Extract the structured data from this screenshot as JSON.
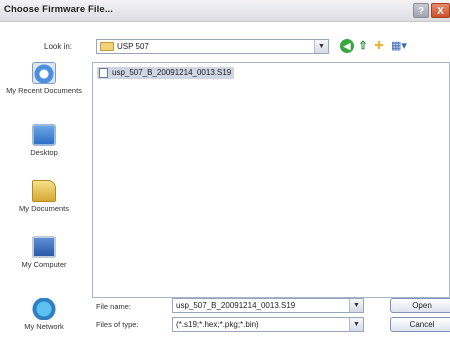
{
  "window": {
    "title": "Choose Firmware File...",
    "help_label": "?",
    "close_label": "X"
  },
  "toolbar": {
    "look_in_label": "Look in:",
    "look_in_value": "USP 507",
    "back_icon": "back-icon",
    "up_icon": "up-folder-icon",
    "new_folder_icon": "new-folder-icon",
    "views_icon": "views-menu-icon"
  },
  "places": [
    {
      "label": "My Recent Documents",
      "icon": "recent-documents-icon"
    },
    {
      "label": "Desktop",
      "icon": "desktop-icon"
    },
    {
      "label": "My Documents",
      "icon": "my-documents-icon"
    },
    {
      "label": "My Computer",
      "icon": "my-computer-icon"
    },
    {
      "label": "My Network",
      "icon": "my-network-icon"
    }
  ],
  "files": [
    {
      "name": "usp_507_B_20091214_0013.S19",
      "selected": true
    }
  ],
  "form": {
    "file_name_label": "File name:",
    "file_name_value": "usp_507_B_20091214_0013.S19",
    "file_type_label": "Files of type:",
    "file_type_value": "(*.s19;*.hex;*.pkg;*.bin)"
  },
  "buttons": {
    "open": "Open",
    "cancel": "Cancel"
  }
}
